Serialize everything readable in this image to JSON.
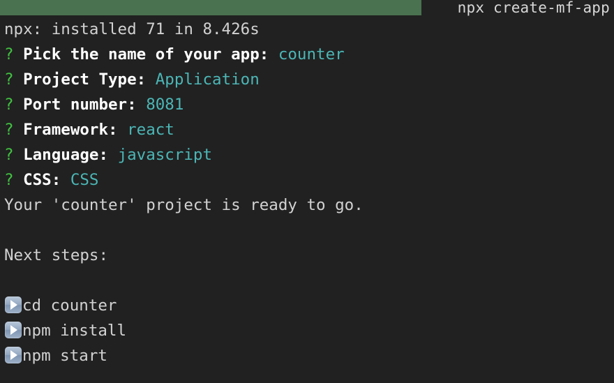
{
  "window": {
    "title": "npx create-mf-app",
    "titlebar_color": "#4a7150",
    "background_color": "#212121"
  },
  "colors": {
    "prompt_marker": "#41c141",
    "prompt_label": "#ffffff",
    "answer_value": "#4cb6b6",
    "plain_text": "#d2d2d2"
  },
  "output": {
    "install_line": "npx: installed 71 in 8.426s",
    "prompts": [
      {
        "marker": "?",
        "label": "Pick the name of your app:",
        "answer": "counter"
      },
      {
        "marker": "?",
        "label": "Project Type:",
        "answer": "Application"
      },
      {
        "marker": "?",
        "label": "Port number:",
        "answer": "8081"
      },
      {
        "marker": "?",
        "label": "Framework:",
        "answer": "react"
      },
      {
        "marker": "?",
        "label": "Language:",
        "answer": "javascript"
      },
      {
        "marker": "?",
        "label": "CSS:",
        "answer": "CSS"
      }
    ],
    "ready_line": "Your 'counter' project is ready to go.",
    "next_steps_heading": "Next steps:",
    "steps": [
      {
        "icon": "play-button-icon",
        "command": "cd counter"
      },
      {
        "icon": "play-button-icon",
        "command": "npm install"
      },
      {
        "icon": "play-button-icon",
        "command": "npm start"
      }
    ]
  }
}
